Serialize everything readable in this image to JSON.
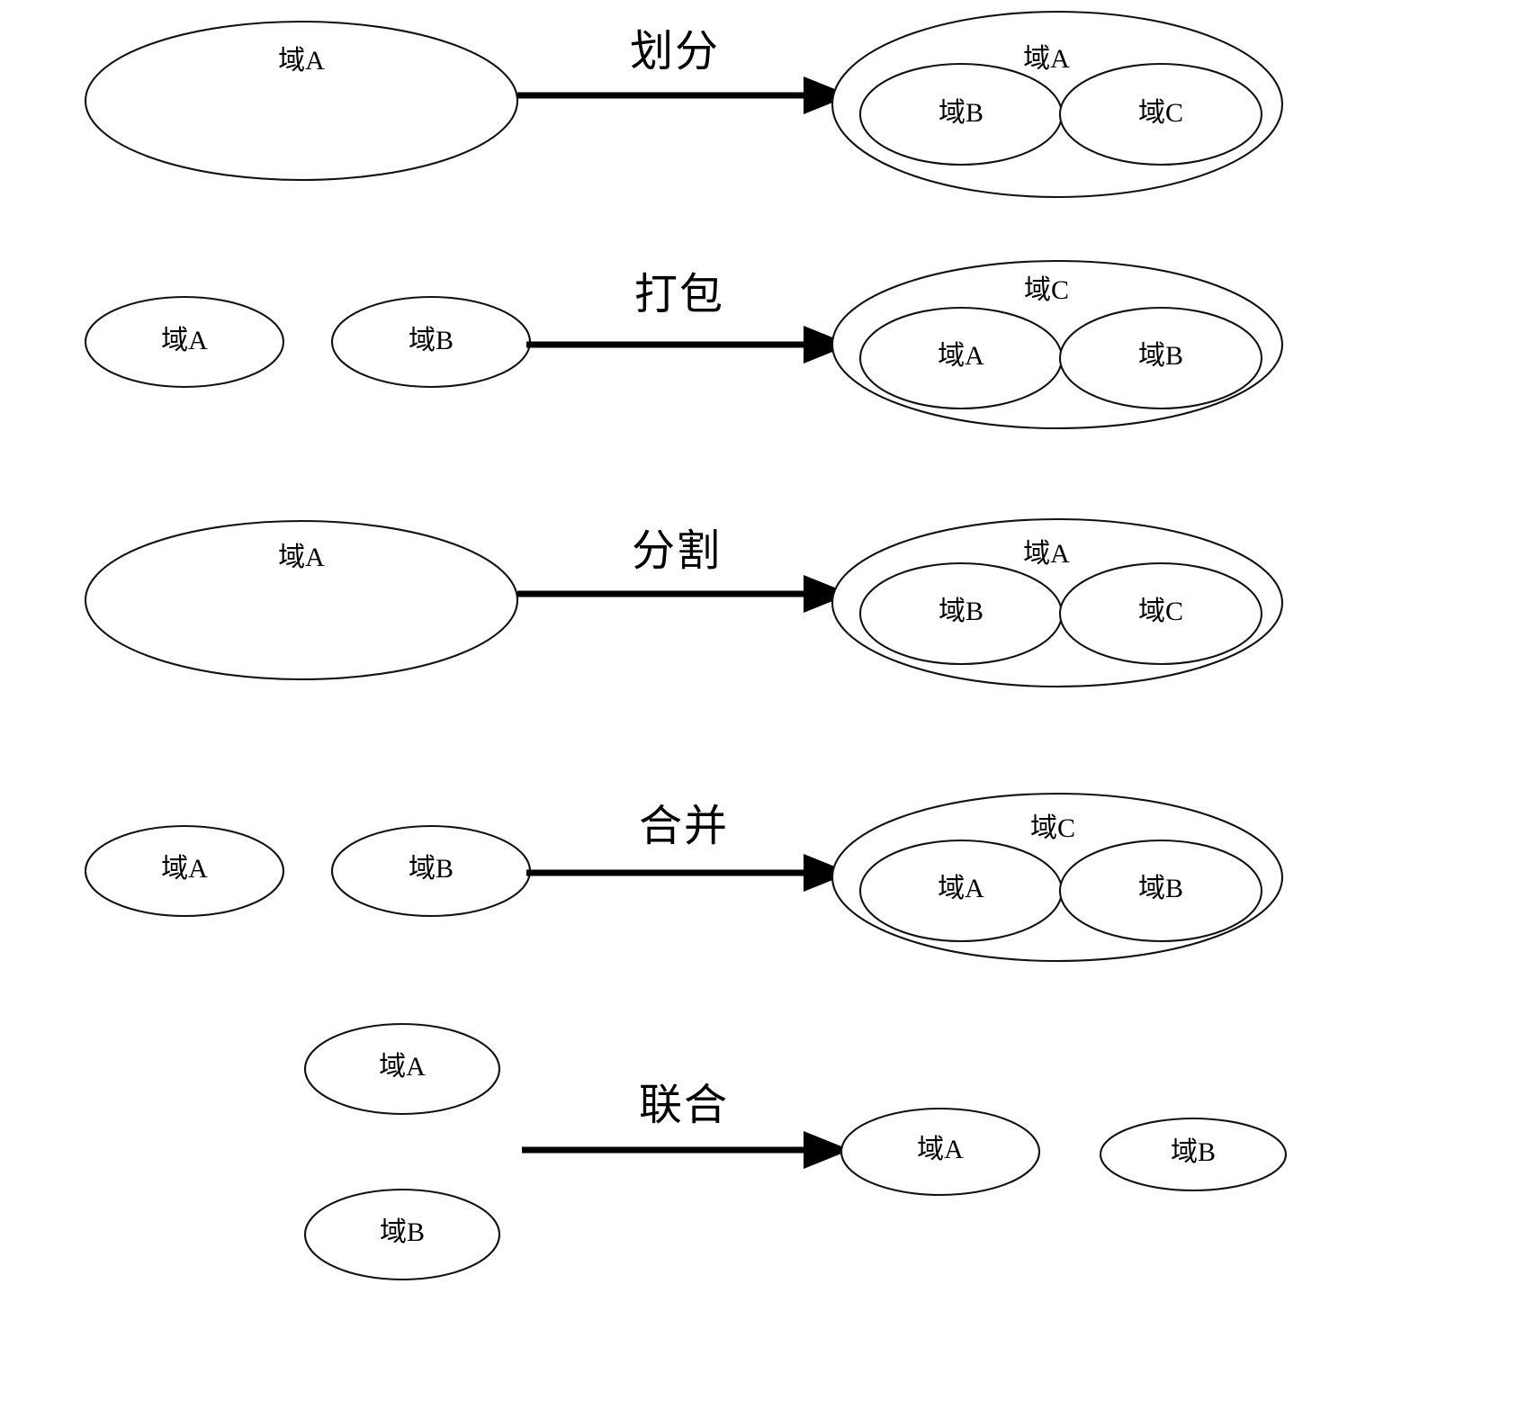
{
  "figure": {
    "kind": "domain-operations-diagram",
    "background_color": "#ffffff",
    "stroke_color": "#111111",
    "text_color": "#000000"
  },
  "rows": [
    {
      "id": "row-partition",
      "operation_label": "划分",
      "left": [
        {
          "id": "r1-left-a",
          "label": "域A"
        }
      ],
      "right_outer": {
        "id": "r1-right-outer",
        "label": "域A"
      },
      "right_inner": [
        {
          "id": "r1-right-b",
          "label": "域B"
        },
        {
          "id": "r1-right-c",
          "label": "域C"
        }
      ]
    },
    {
      "id": "row-package",
      "operation_label": "打包",
      "left": [
        {
          "id": "r2-left-a",
          "label": "域A"
        },
        {
          "id": "r2-left-b",
          "label": "域B"
        }
      ],
      "right_outer": {
        "id": "r2-right-outer",
        "label": "域C"
      },
      "right_inner": [
        {
          "id": "r2-right-a",
          "label": "域A"
        },
        {
          "id": "r2-right-b",
          "label": "域B"
        }
      ]
    },
    {
      "id": "row-split",
      "operation_label": "分割",
      "left": [
        {
          "id": "r3-left-a",
          "label": "域A"
        }
      ],
      "right_outer": {
        "id": "r3-right-outer",
        "label": "域A"
      },
      "right_inner": [
        {
          "id": "r3-right-b",
          "label": "域B"
        },
        {
          "id": "r3-right-c",
          "label": "域C"
        }
      ]
    },
    {
      "id": "row-merge",
      "operation_label": "合并",
      "left": [
        {
          "id": "r4-left-a",
          "label": "域A"
        },
        {
          "id": "r4-left-b",
          "label": "域B"
        }
      ],
      "right_outer": {
        "id": "r4-right-outer",
        "label": "域C"
      },
      "right_inner": [
        {
          "id": "r4-right-a",
          "label": "域A"
        },
        {
          "id": "r4-right-b",
          "label": "域B"
        }
      ]
    },
    {
      "id": "row-federate",
      "operation_label": "联合",
      "left": [
        {
          "id": "r5-left-a",
          "label": "域A"
        },
        {
          "id": "r5-left-b",
          "label": "域B"
        }
      ],
      "right_outer": null,
      "right_inner": [
        {
          "id": "r5-right-a",
          "label": "域A"
        },
        {
          "id": "r5-right-b",
          "label": "域B"
        }
      ]
    }
  ]
}
